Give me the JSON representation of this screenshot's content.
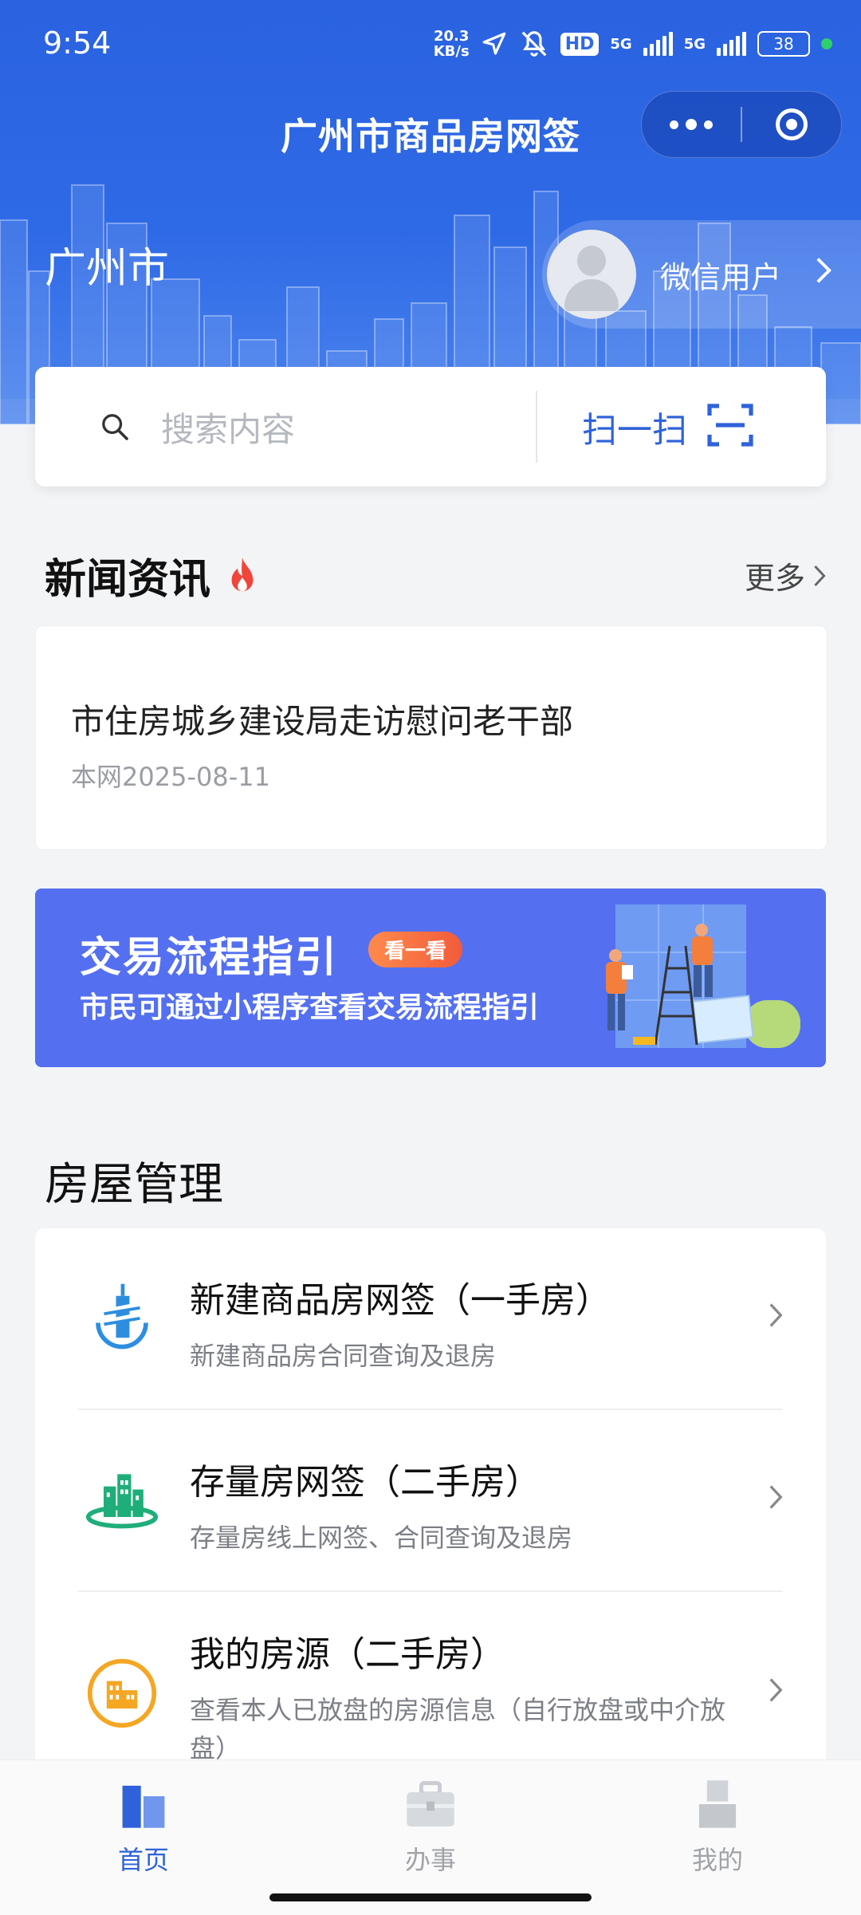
{
  "status_bar": {
    "time": "9:54",
    "net_speed_value": "20.3",
    "net_speed_unit": "KB/s",
    "hd_badge": "HD",
    "sim1": "5G",
    "sim2": "5G",
    "battery": "38"
  },
  "header": {
    "title": "广州市商品房网签",
    "city": "广州市",
    "user_name": "微信用户"
  },
  "search": {
    "placeholder": "搜索内容",
    "scan_label": "扫一扫"
  },
  "news": {
    "section_title": "新闻资讯",
    "more_label": "更多",
    "items": [
      {
        "headline": "市住房城乡建设局走访慰问老干部",
        "meta": "本网2025-08-11"
      }
    ]
  },
  "banner": {
    "title": "交易流程指引",
    "badge": "看一看",
    "subtitle": "市民可通过小程序查看交易流程指引"
  },
  "house_management": {
    "section_title": "房屋管理",
    "items": [
      {
        "name": "新建商品房网签（一手房）",
        "desc": "新建商品房合同查询及退房",
        "icon": "building-tower-icon"
      },
      {
        "name": "存量房网签（二手房）",
        "desc": "存量房线上网签、合同查询及退房",
        "icon": "city-buildings-icon"
      },
      {
        "name": "我的房源（二手房）",
        "desc": "查看本人已放盘的房源信息（自行放盘或中介放盘）",
        "icon": "house-listing-icon"
      }
    ]
  },
  "tabbar": {
    "items": [
      {
        "label": "首页",
        "active": true
      },
      {
        "label": "办事",
        "active": false
      },
      {
        "label": "我的",
        "active": false
      }
    ]
  },
  "colors": {
    "primary": "#2f6ae6",
    "banner": "#5470f0",
    "accent_orange": "#f5a623",
    "accent_green": "#1fae7a",
    "tab_active": "#2f62da",
    "tab_inactive": "#a0a3a8"
  }
}
